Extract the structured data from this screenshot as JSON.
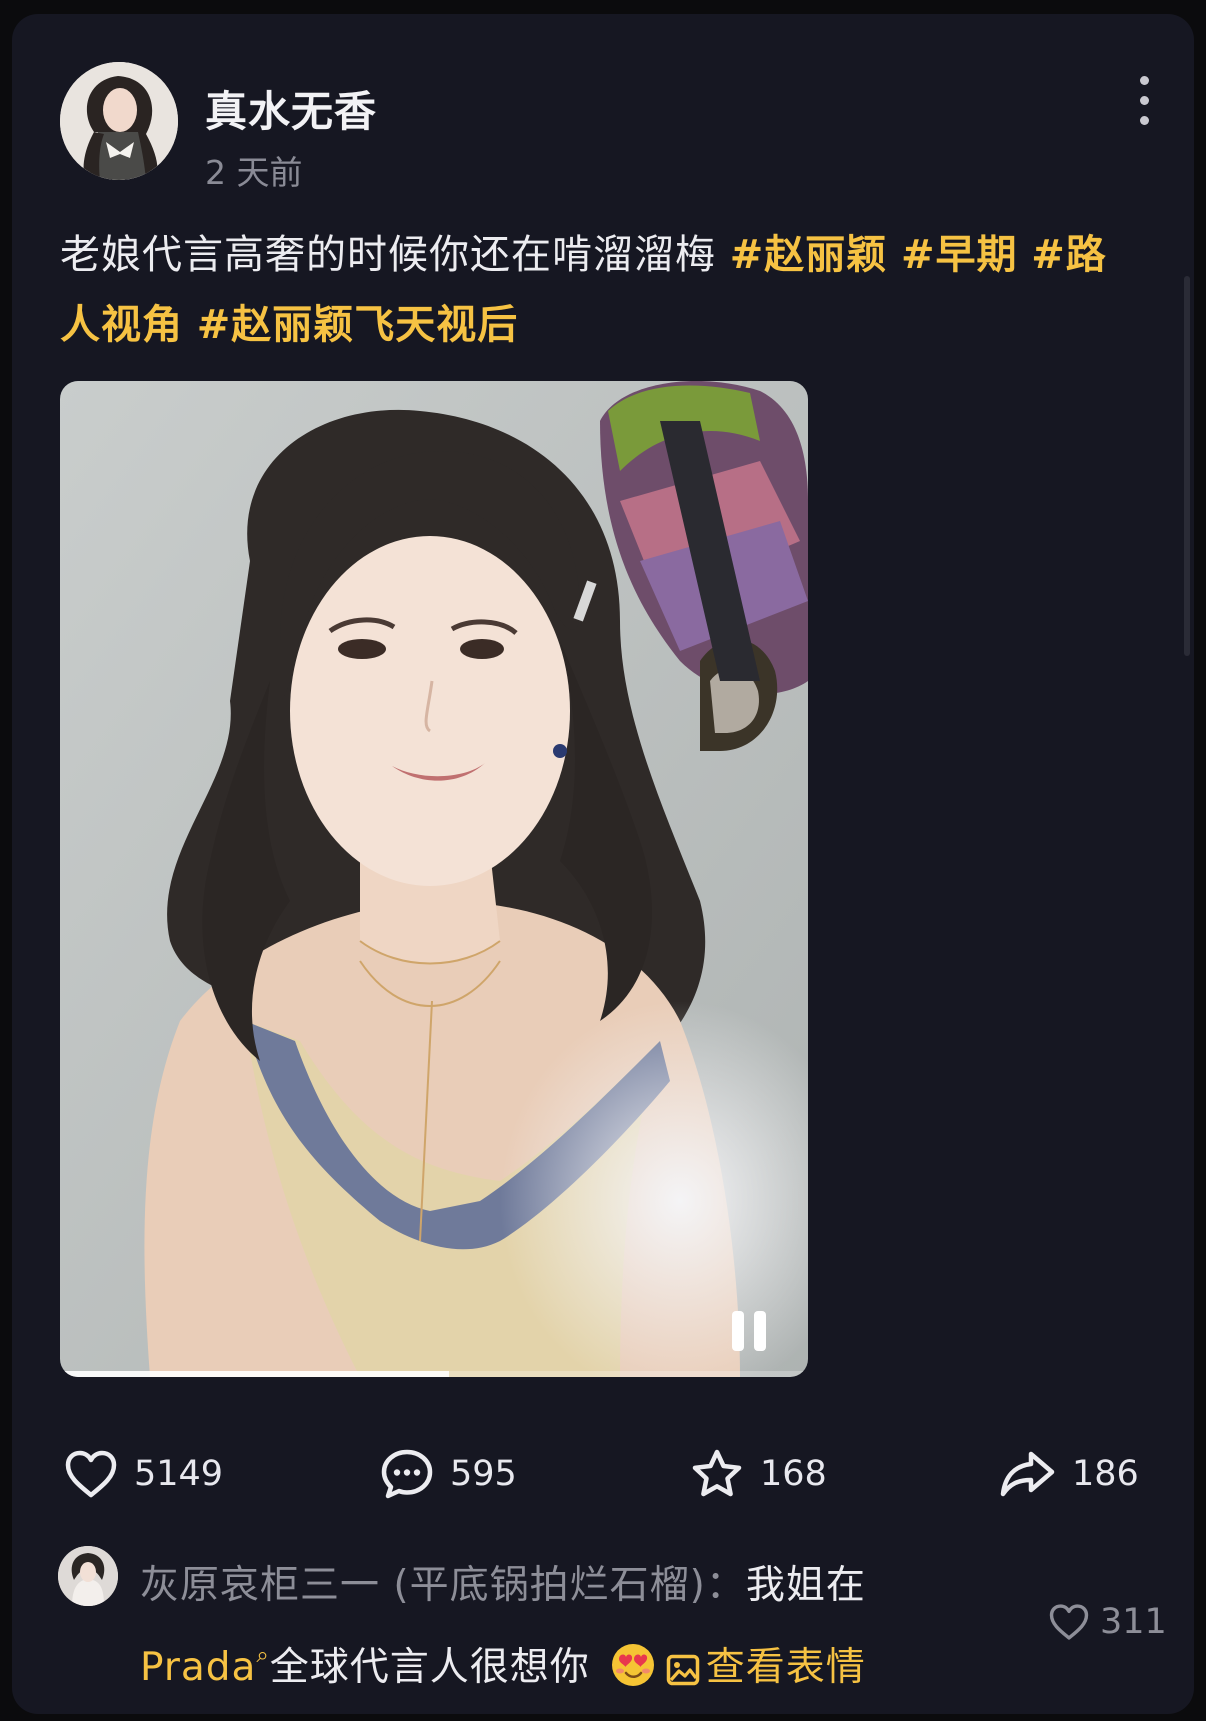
{
  "post": {
    "author_name": "真水无香",
    "time": "2 天前",
    "caption_text": "老娘代言高奢的时候你还在啃溜溜梅 ",
    "hashtags": [
      "#赵丽颖",
      "#早期",
      "#路人视角",
      "#赵丽颖飞天视后"
    ]
  },
  "video": {
    "progress": 0.52,
    "pause_icon": "pause-icon"
  },
  "actions": {
    "likes": "5149",
    "comments": "595",
    "favorites": "168",
    "shares": "186"
  },
  "comment": {
    "user": "灰原哀柜三一 (平底锅拍烂石榴)：",
    "text_part1": "我姐在",
    "link_text": "Prada",
    "text_part2": "全球代言人很想你",
    "emoji": "heart-eyes-emoji",
    "view_sticker_label": "查看表情",
    "likes": "311"
  },
  "colors": {
    "background": "#0b0b0d",
    "card": "#161722",
    "accent": "#f6c243",
    "muted": "#8a8b96"
  }
}
